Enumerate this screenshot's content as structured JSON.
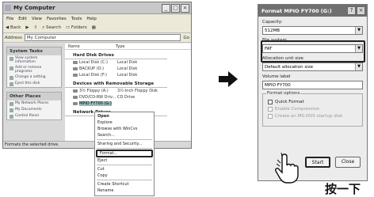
{
  "explorer": {
    "title": "My Computer",
    "menu": [
      "File",
      "Edit",
      "View",
      "Favorites",
      "Tools",
      "Help"
    ],
    "toolbar": [
      "Back",
      "Search",
      "Folders"
    ],
    "address_label": "Address",
    "address_value": "My Computer",
    "go_label": "Go",
    "columns": [
      "Name",
      "Type"
    ],
    "task_panels": [
      {
        "title": "System Tasks",
        "items": [
          "View system information",
          "Add or remove programs",
          "Change a setting",
          "Eject this disk"
        ]
      },
      {
        "title": "Other Places",
        "items": [
          "My Network Places",
          "My Documents",
          "Control Panel"
        ]
      }
    ],
    "groups": [
      {
        "title": "Hard Disk Drives",
        "rows": [
          {
            "name": "Local Disk (C:)",
            "type": "Local Disk"
          },
          {
            "name": "BACKUP (D:)",
            "type": "Local Disk"
          },
          {
            "name": "Local Disk (F:)",
            "type": "Local Disk"
          }
        ]
      },
      {
        "title": "Devices with Removable Storage",
        "rows": [
          {
            "name": "3½ Floppy (A:)",
            "type": "3½-Inch Floppy Disk"
          },
          {
            "name": "DVD/CD-RW Driv...",
            "type": "CD Drive"
          },
          {
            "name": "MPIO FY700 (G:)",
            "type": "Removable Disk"
          }
        ]
      },
      {
        "title": "Network Drives",
        "rows": []
      }
    ],
    "status": "Formats the selected drive."
  },
  "context_menu": {
    "items": [
      "Open",
      "Explore",
      "Browse with WinCvs",
      "Search...",
      "Sharing and Security...",
      "Format...",
      "Eject",
      "Cut",
      "Copy",
      "Create Shortcut",
      "Rename"
    ]
  },
  "dialog": {
    "title": "Format MPIO FY700 (G:)",
    "capacity_label": "Capacity:",
    "capacity_value": "512MB",
    "fs_label": "File system",
    "fs_value": "FAT",
    "alloc_label": "Allocation unit size",
    "alloc_value": "Default allocation size",
    "volume_label": "Volume label",
    "volume_value": "MPIO FY700",
    "options_label": "Format options",
    "opt_quick": "Quick Format",
    "opt_compress": "Enable Compression",
    "opt_startup": "Create an MS-DOS startup disk",
    "start_label": "Start",
    "close_label": "Close"
  },
  "annotation": "按一下"
}
